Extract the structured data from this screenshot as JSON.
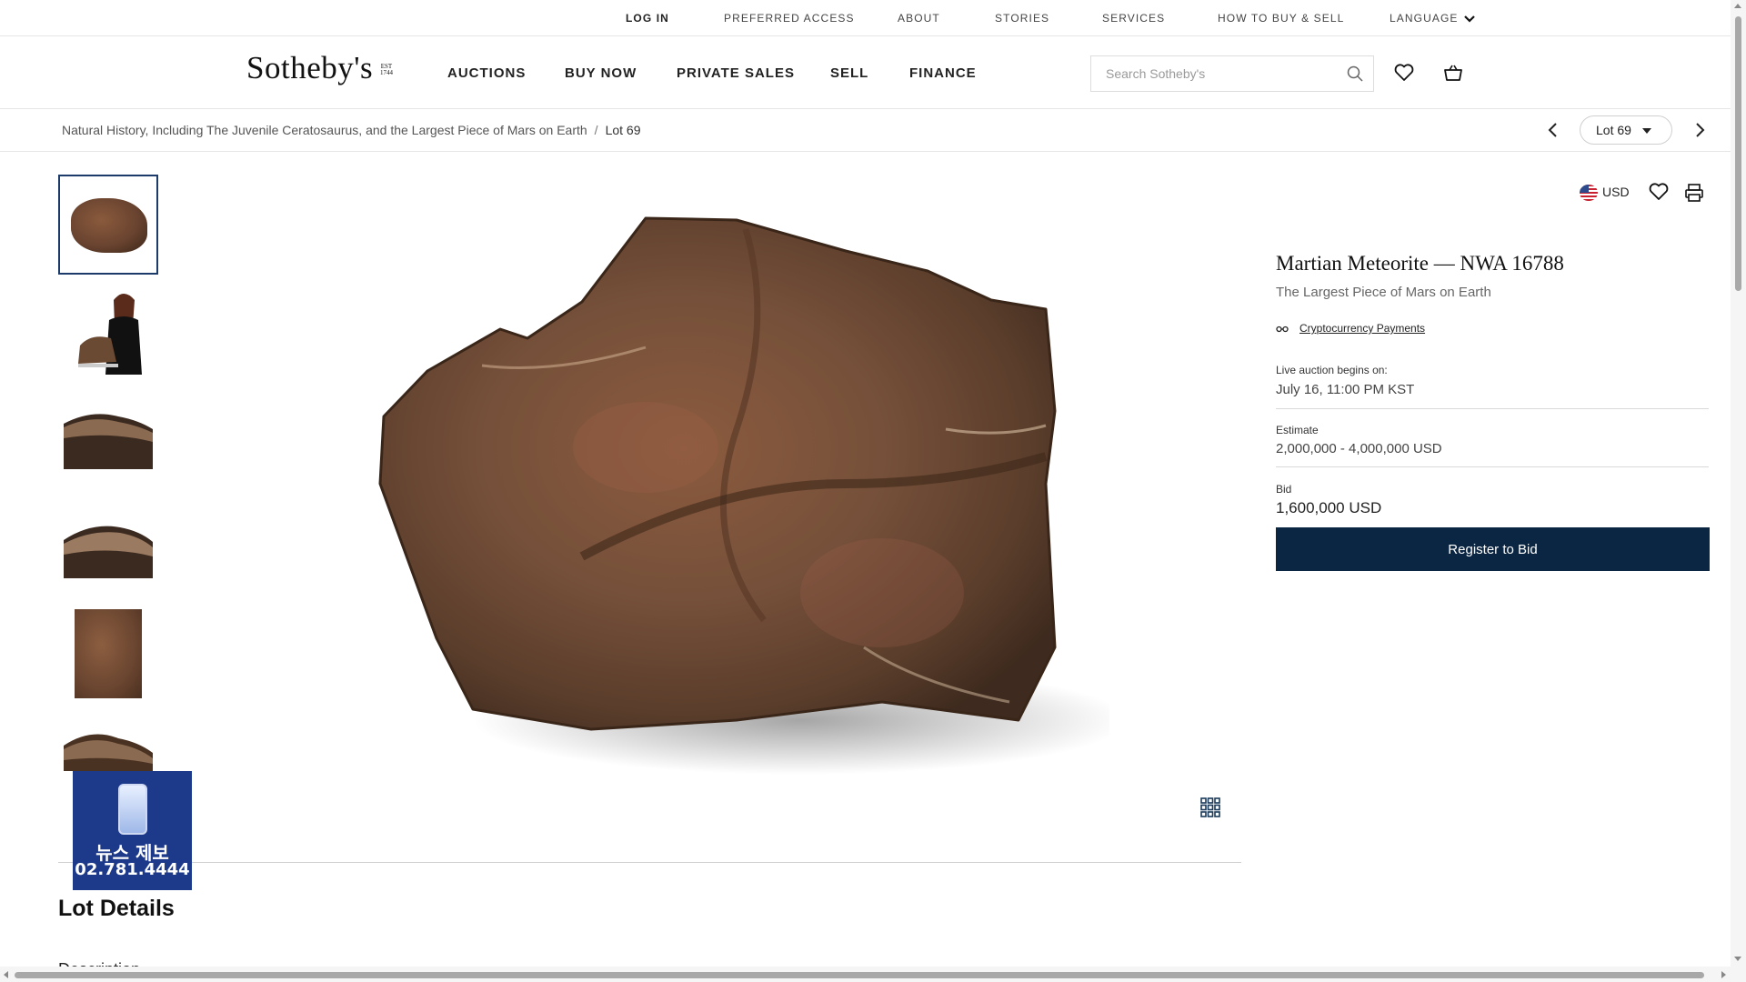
{
  "utility_nav": {
    "login": "LOG IN",
    "preferred_access": "PREFERRED ACCESS",
    "about": "ABOUT",
    "stories": "STORIES",
    "services": "SERVICES",
    "how_to": "HOW TO BUY & SELL",
    "language": "LANGUAGE"
  },
  "header": {
    "logo": "Sotheby's",
    "logo_est": "EST 1744",
    "nav": [
      "AUCTIONS",
      "BUY NOW",
      "PRIVATE SALES",
      "SELL",
      "FINANCE"
    ],
    "search_placeholder": "Search Sotheby's"
  },
  "breadcrumb": {
    "sale": "Natural History, Including The Juvenile Ceratosaurus, and the Largest Piece of Mars on Earth",
    "separator": "/",
    "current": "Lot 69"
  },
  "lot_nav": {
    "selected": "Lot 69"
  },
  "lot": {
    "currency": "USD",
    "title": "Martian Meteorite — NWA 16788",
    "subtitle": "The Largest Piece of Mars on Earth",
    "crypto_link": "Cryptocurrency Payments",
    "auction_label": "Live auction begins on:",
    "auction_date": "July 16, 11:00 PM KST",
    "estimate_label": "Estimate",
    "estimate_value": "2,000,000 - 4,000,000 USD",
    "bid_label": "Bid",
    "bid_value": "1,600,000 USD",
    "register_button": "Register to Bid"
  },
  "news_overlay": {
    "line1": "뉴스 제보",
    "line2": "02.781.4444"
  },
  "details": {
    "heading": "Lot Details",
    "description": "Description"
  },
  "colors": {
    "accent_navy": "#0b2642",
    "thumb_border": "#1d3b6a",
    "news_blue": "#1d3a8a"
  }
}
